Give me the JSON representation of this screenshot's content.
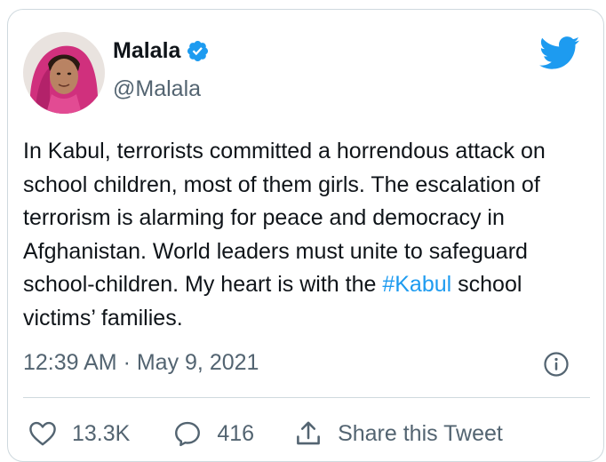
{
  "author": {
    "display_name": "Malala",
    "handle": "@Malala",
    "verified_icon": "verified-badge-icon",
    "avatar_icon": "avatar-photo"
  },
  "brand": {
    "icon": "twitter-bird-icon",
    "color": "#1d9bf0"
  },
  "tweet": {
    "text_before": "In Kabul, terrorists committed a horrendous attack on school children, most of them girls. The escalation of terrorism is alarming for peace and democracy in Afghanistan. World leaders must unite to safeguard school-children. My heart is with the ",
    "hashtag": "#Kabul",
    "text_after": " school victims’ families.",
    "timestamp": "12:39 AM · May 9, 2021",
    "info_icon": "info-icon"
  },
  "actions": {
    "like_icon": "heart-icon",
    "like_count": "13.3K",
    "reply_icon": "reply-bubble-icon",
    "reply_count": "416",
    "share_icon": "share-icon",
    "share_label": "Share this Tweet"
  },
  "colors": {
    "text": "#0f1419",
    "secondary": "#536471",
    "link": "#1d9bf0",
    "border": "#cfd9de"
  }
}
